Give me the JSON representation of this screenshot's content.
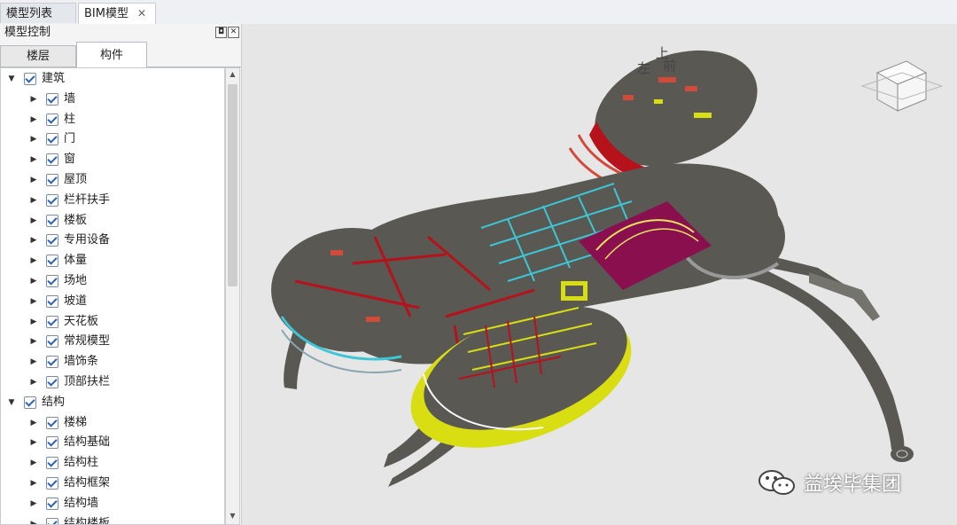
{
  "tabs": [
    {
      "label": "模型列表",
      "close": "✕"
    },
    {
      "label": "BIM模型",
      "close": "✕"
    }
  ],
  "panel": {
    "title": "模型控制",
    "subtabs": [
      "楼层",
      "构件"
    ]
  },
  "viewcube": {
    "top": "上",
    "left": "左",
    "front": "前"
  },
  "tree": [
    {
      "label": "建筑",
      "level": 0,
      "expanded": true
    },
    {
      "label": "墙",
      "level": 1
    },
    {
      "label": "柱",
      "level": 1
    },
    {
      "label": "门",
      "level": 1
    },
    {
      "label": "窗",
      "level": 1
    },
    {
      "label": "屋顶",
      "level": 1
    },
    {
      "label": "栏杆扶手",
      "level": 1
    },
    {
      "label": "楼板",
      "level": 1
    },
    {
      "label": "专用设备",
      "level": 1
    },
    {
      "label": "体量",
      "level": 1
    },
    {
      "label": "场地",
      "level": 1
    },
    {
      "label": "坡道",
      "level": 1
    },
    {
      "label": "天花板",
      "level": 1
    },
    {
      "label": "常规模型",
      "level": 1
    },
    {
      "label": "墙饰条",
      "level": 1
    },
    {
      "label": "顶部扶栏",
      "level": 1
    },
    {
      "label": "结构",
      "level": 0,
      "expanded": true
    },
    {
      "label": "楼梯",
      "level": 1
    },
    {
      "label": "结构基础",
      "level": 1
    },
    {
      "label": "结构柱",
      "level": 1
    },
    {
      "label": "结构框架",
      "level": 1
    },
    {
      "label": "结构墙",
      "level": 1
    },
    {
      "label": "结构楼板",
      "level": 1
    }
  ],
  "watermark": "益埃毕集团",
  "colors": {
    "slab": "#5a5853",
    "accent_red": "#b5121b",
    "accent_yellow": "#d8de12",
    "accent_cyan": "#3cc6d6",
    "accent_magenta": "#8a0f4f"
  }
}
